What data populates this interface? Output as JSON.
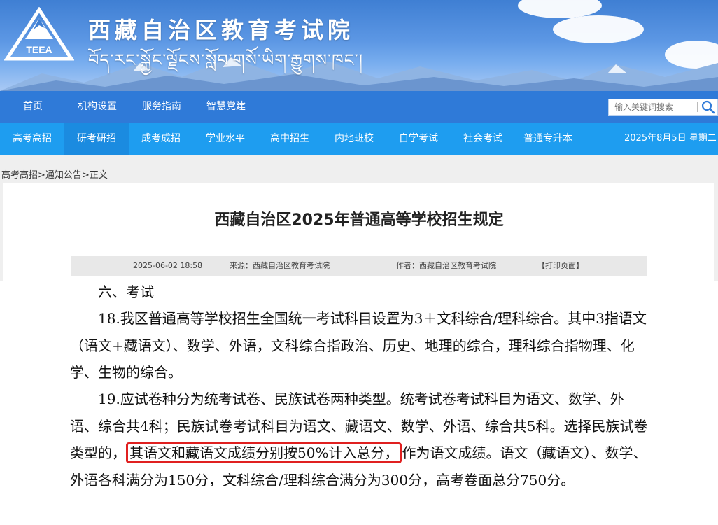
{
  "header": {
    "site_title": "西藏自治区教育考试院",
    "site_subtitle": "བོད་རང་སྐྱོང་ལྗོངས་སློབ་གསོ་ཡིག་རྒྱུགས་ཁང་།",
    "logo_text": "TEEA"
  },
  "nav_main": [
    "首页",
    "机构设置",
    "服务指南",
    "智慧党建"
  ],
  "search": {
    "placeholder": "输入关键词搜索",
    "icon": "search-icon"
  },
  "nav_sub": [
    "高考高招",
    "研考研招",
    "成考成招",
    "学业水平",
    "高中招生",
    "内地班校",
    "自学考试",
    "社会考试",
    "普通专升本"
  ],
  "nav_sub_active": "研考研招",
  "date": "2025年8月5日 星期二",
  "breadcrumb": [
    "高考高招",
    ">",
    "通知公告",
    ">",
    "正文"
  ],
  "article": {
    "title": "西藏自治区2025年普通高等学校招生规定",
    "meta": {
      "date": "2025-06-02 18:58",
      "source": "来源：西藏自治区教育考试院",
      "author": "作者：西藏自治区教育考试院",
      "print": "【打印页面】"
    },
    "section_heading": "六、考试",
    "p18": "18.我区普通高等学校招生全国统一考试科目设置为3＋文科综合/理科综合。其中3指语文（语文+藏语文）、数学、外语，文科综合指政治、历史、地理的综合，理科综合指物理、化学、生物的综合。",
    "p19_before": "19.应试卷种分为统考试卷、民族试卷两种类型。统考试卷考试科目为语文、数学、外语、综合共4科；民族试卷考试科目为语文、藏语文、数学、外语、综合共5科。选择民族试卷类型的，",
    "p19_highlight": "其语文和藏语文成绩分别按50%计入总分，",
    "p19_after": "作为语文成绩。语文（藏语文）、数学、外语各科满分为150分，文科综合/理科综合满分为300分，高考卷面总分750分。"
  },
  "colors": {
    "nav_main_bg": "#2f7ad8",
    "nav_sub_bg": "#1e9df0",
    "highlight_border": "#e02020"
  }
}
